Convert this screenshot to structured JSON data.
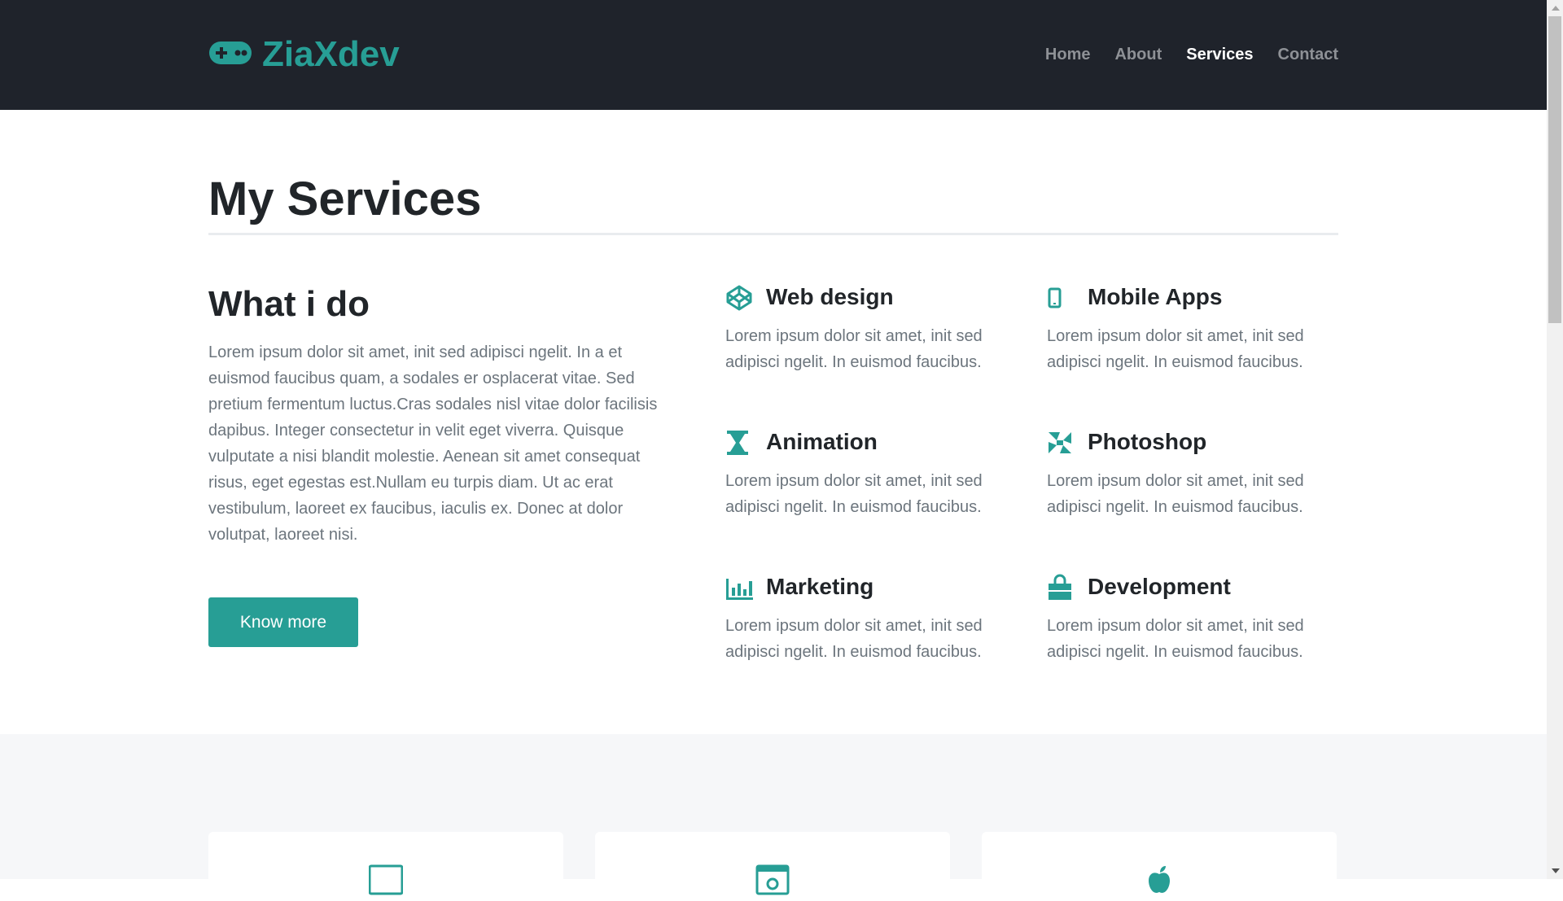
{
  "brand": {
    "name": "ZiaXdev",
    "icon": "gamepad-icon",
    "color": "#279e95"
  },
  "nav": {
    "items": [
      {
        "label": "Home",
        "active": false
      },
      {
        "label": "About",
        "active": false
      },
      {
        "label": "Services",
        "active": true
      },
      {
        "label": "Contact",
        "active": false
      }
    ]
  },
  "page": {
    "title": "My Services"
  },
  "intro": {
    "heading": "What i do",
    "text": "Lorem ipsum dolor sit amet, init sed adipisci ngelit. In a et euismod faucibus quam, a sodales er osplacerat vitae. Sed pretium fermentum luctus.Cras sodales nisl vitae dolor facilisis dapibus. Integer consectetur in velit eget viverra. Quisque vulputate a nisi blandit molestie. Aenean sit amet consequat risus, eget egestas est.Nullam eu turpis diam. Ut ac erat vestibulum, laoreet ex faucibus, iaculis ex. Donec at dolor volutpat, laoreet nisi.",
    "button": "Know more"
  },
  "services": [
    {
      "title": "Web design",
      "icon": "codepen-icon",
      "text": "Lorem ipsum dolor sit amet, init sed adipisci ngelit. In euismod faucibus."
    },
    {
      "title": "Mobile Apps",
      "icon": "mobile-icon",
      "text": "Lorem ipsum dolor sit amet, init sed adipisci ngelit. In euismod faucibus."
    },
    {
      "title": "Animation",
      "icon": "hourglass-icon",
      "text": "Lorem ipsum dolor sit amet, init sed adipisci ngelit. In euismod faucibus."
    },
    {
      "title": "Photoshop",
      "icon": "photoshop-icon",
      "text": "Lorem ipsum dolor sit amet, init sed adipisci ngelit. In euismod faucibus."
    },
    {
      "title": "Marketing",
      "icon": "bar-chart-icon",
      "text": "Lorem ipsum dolor sit amet, init sed adipisci ngelit. In euismod faucibus."
    },
    {
      "title": "Development",
      "icon": "shopping-bag-icon",
      "text": "Lorem ipsum dolor sit amet, init sed adipisci ngelit. In euismod faucibus."
    }
  ],
  "cards": [
    {
      "icon": "monitor-icon"
    },
    {
      "icon": "browser-window-icon"
    },
    {
      "icon": "apple-icon"
    }
  ],
  "colors": {
    "accent": "#279e95",
    "navbar": "#1f232b",
    "text": "#212529",
    "muted": "#6c757d"
  }
}
